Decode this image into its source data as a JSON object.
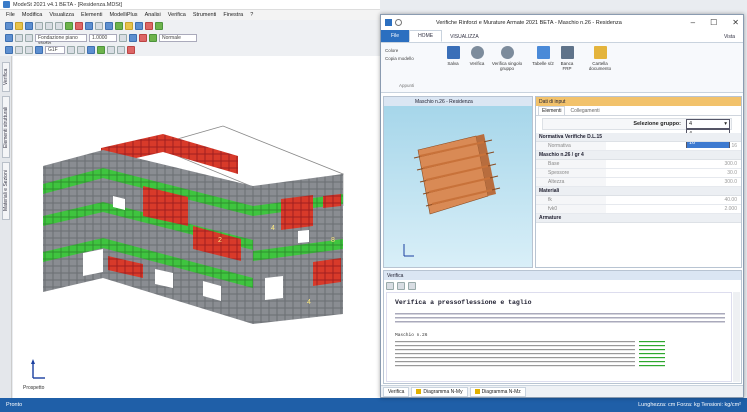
{
  "main_window": {
    "title": "ModeSt 2021 v4.1 BETA - [Residenza.MDSt]",
    "menu": [
      "File",
      "Modifica",
      "Visualizza",
      "Elementi",
      "ModelliPlus",
      "Analisi",
      "Verifica",
      "Strumenti",
      "Finestra",
      "?"
    ],
    "level_select": "1.0000",
    "floor_select": "Fondazione piano stadio",
    "view_select": "Normale",
    "combo_select": "G1F",
    "vertical_tabs": [
      "Verifica",
      "Elementi strutturali",
      "Materiali e Sezioni"
    ],
    "axis_label": "Prospetto",
    "status_left": "Pronto",
    "status_right": "Lunghezza: cm  Forza: kg  Tensioni: kg/cm²"
  },
  "dialog": {
    "title": "Verifiche Rinforzi e Murature Armate 2021 BETA - Maschio n.26 - Residenza",
    "window_buttons": [
      "–",
      "☐",
      "✕"
    ],
    "ribbon_tabs": [
      "File",
      "HOME",
      "VISUALIZZA"
    ],
    "ribbon_right": "Vista",
    "ribbon_group_left": {
      "items": [
        "Colore",
        "Copia modello"
      ],
      "label": "Appunti"
    },
    "ribbon_buttons": [
      "Salva",
      "Verifica",
      "Verifica singolo gruppo",
      "Tabelle s/2",
      "Banca FRP",
      "Cartella documento"
    ],
    "preview_title": "Maschio n.26 - Residenza",
    "panel_title": "Dati di input",
    "panel_tabs": [
      "Elementi",
      "Collegamenti"
    ],
    "group_label": "Selezione gruppo:",
    "group_value": "4",
    "dropdown_options": [
      "4",
      "16"
    ],
    "properties": [
      {
        "category": "Normativa Verifiche D.L.15",
        "rows": [
          {
            "key": "Normativa",
            "value": "16"
          }
        ]
      },
      {
        "category": "Maschio n.26 / gr 4",
        "rows": [
          {
            "key": "Base",
            "value": "300.0"
          },
          {
            "key": "Spessore",
            "value": "30.0"
          },
          {
            "key": "Altezza",
            "value": "300.0"
          }
        ]
      },
      {
        "category": "Materiali",
        "rows": [
          {
            "key": "fk",
            "value": "40.00"
          },
          {
            "key": "fvk0",
            "value": "2.000"
          }
        ]
      },
      {
        "category": "Armature",
        "rows": []
      }
    ],
    "output_title": "Verifica",
    "output_heading": "Verifica a pressoflessione e taglio",
    "output_subheading": "Maschio n.26",
    "bottom_tabs": [
      "Verifica",
      "Diagramma N-My",
      "Diagramma N-Mz"
    ]
  }
}
